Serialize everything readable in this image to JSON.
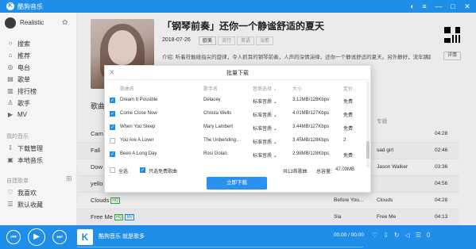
{
  "app": {
    "title": "酷狗音乐",
    "logo_letter": "K"
  },
  "window_controls": [
    "skin-icon",
    "menu-icon",
    "minimize-icon",
    "maximize-icon",
    "close-icon"
  ],
  "sidebar": {
    "user_name": "Realistic",
    "items": [
      {
        "label": "搜索",
        "icon": "search-icon"
      },
      {
        "label": "推荐",
        "icon": "home-icon"
      },
      {
        "label": "电台",
        "icon": "radio-icon"
      },
      {
        "label": "歌单",
        "icon": "playlist-icon"
      },
      {
        "label": "排行榜",
        "icon": "rank-icon"
      },
      {
        "label": "歌手",
        "icon": "singer-icon"
      },
      {
        "label": "MV",
        "icon": "mv-icon"
      }
    ],
    "section_mine": "我的音乐",
    "mine_items": [
      {
        "label": "下载管理",
        "icon": "download-icon"
      },
      {
        "label": "本地音乐",
        "icon": "local-music-icon"
      }
    ],
    "section_created": "自建歌单",
    "created_items": [
      {
        "label": "我喜欢",
        "icon": "heart-icon"
      },
      {
        "label": "默认收藏",
        "icon": "list-icon"
      }
    ]
  },
  "album": {
    "title": "「钢琴前奏」还你一个静谧舒适的夏天",
    "date": "2018-07-26",
    "tags": [
      "欧美",
      "流行",
      "英语",
      "治愈"
    ],
    "intro": "介绍:  听着符触碰指尖的旋律，令人抓耳的钢琴前奏，人声的深情演绎，还你一个静谧舒适的夏天。另外静好，流年蹒跚，",
    "detail_label": "详情"
  },
  "song_list": {
    "heading": "歌曲",
    "album_col": "专辑",
    "rows": [
      {
        "title": "Cam",
        "singer": "",
        "album": "",
        "duration": "04:28",
        "hq": false,
        "mv": false
      },
      {
        "title": "Fall",
        "singer": "",
        "album": "sad girl",
        "duration": "02:46",
        "hq": false,
        "mv": false
      },
      {
        "title": "Dow",
        "singer": "",
        "album": "Jason Walker",
        "duration": "03:36",
        "hq": false,
        "mv": false
      },
      {
        "title": "yello",
        "singer": "",
        "album": "",
        "duration": "04:56",
        "hq": false,
        "mv": false
      },
      {
        "title": "Clouds",
        "singer": "Before You...",
        "album": "Clouds",
        "duration": "04:28",
        "hq": true,
        "mv": false
      },
      {
        "title": "Free Me",
        "singer": "Sia",
        "album": "Free Me",
        "duration": "04:13",
        "hq": true,
        "mv": true
      }
    ]
  },
  "badges": {
    "hq": "HQ",
    "mv": "MV"
  },
  "modal": {
    "title": "批量下载",
    "columns": {
      "song": "歌曲名",
      "singer": "歌手名",
      "quality": "音质选择",
      "size": "大小",
      "price": "定价"
    },
    "rows": [
      {
        "checked": true,
        "song": "Dream It Possible",
        "singer": "Delacey",
        "quality": "标准音质",
        "size": "3.12MB/128Kbps",
        "price": "免费"
      },
      {
        "checked": true,
        "song": "Come Close Now",
        "singer": "Christa Wells",
        "quality": "标准音质",
        "size": "4.01MB/127Kbps",
        "price": "免费"
      },
      {
        "checked": true,
        "song": "When You Sleep",
        "singer": "Mary Lambert",
        "quality": "标准音质",
        "size": "3.44MB/127Kbps",
        "price": "免费"
      },
      {
        "checked": false,
        "song": "You Are A Lover",
        "singer": "The Unbending...",
        "quality": "标准音质",
        "size": "3.45MB/128Kbps",
        "price": "2"
      },
      {
        "checked": true,
        "song": "Been A Long Day",
        "singer": "Rosi Golan",
        "quality": "标准音质",
        "size": "2.98MB/128Kbps",
        "price": "免费"
      }
    ],
    "select_all": "全选",
    "free_only": "只选免费歌曲",
    "count": "共13首歌曲",
    "capacity_label": "总容量:",
    "capacity_value": "47.03MB",
    "download_button": "立即下载"
  },
  "player": {
    "now_playing": "酷狗音乐 就是歌多",
    "time": "00:00 / 00:00",
    "icons": [
      "heart-icon",
      "download-icon",
      "loop-icon",
      "volume-icon",
      "playlist-icon"
    ],
    "playlist_count": "0"
  },
  "colors": {
    "accent": "#1f8ee8",
    "hq": "#3bb14c"
  }
}
